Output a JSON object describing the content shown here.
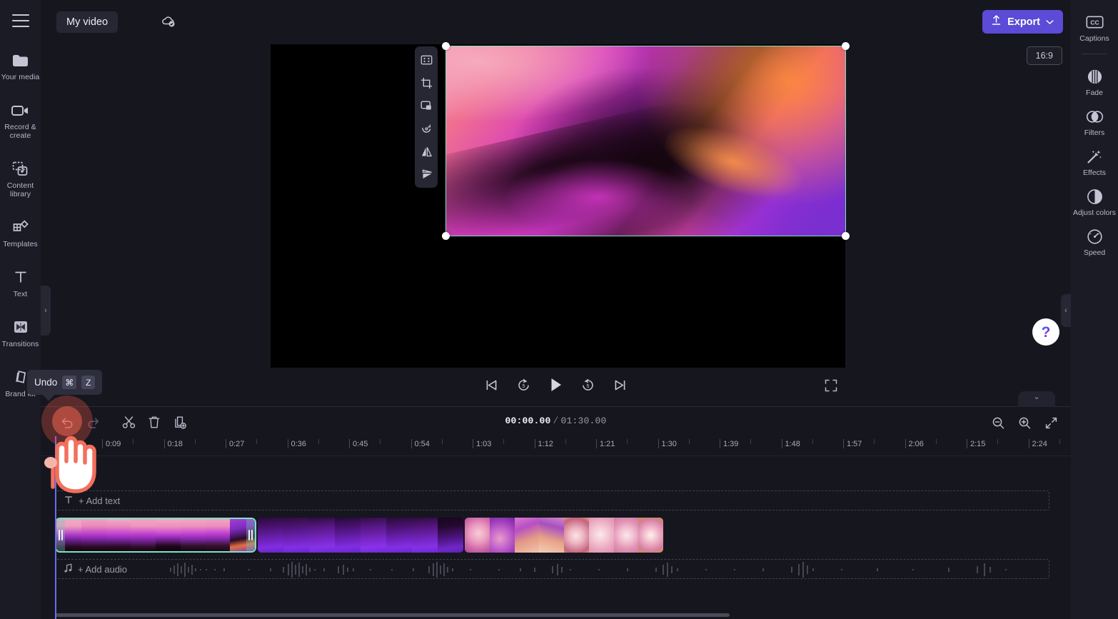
{
  "app": {
    "accent_purple": "#5b4bd6",
    "selection_green": "#79e4c4",
    "panel_bg": "#1b1b26",
    "stage_bg": "#16161f"
  },
  "topbar": {
    "menu_icon": "hamburger-menu-icon",
    "project_name": "My video",
    "save_status_icon": "cloud-saved-icon",
    "export_label": "Export",
    "export_icon": "upload-arrow-icon",
    "export_caret_icon": "chevron-down-icon"
  },
  "left_rail": {
    "items": [
      {
        "label": "Your media",
        "icon": "folder-icon"
      },
      {
        "label": "Record & create",
        "icon": "video-camera-icon"
      },
      {
        "label": "Content library",
        "icon": "content-library-icon"
      },
      {
        "label": "Templates",
        "icon": "templates-icon"
      },
      {
        "label": "Text",
        "icon": "text-t-icon"
      },
      {
        "label": "Transitions",
        "icon": "transitions-icon"
      },
      {
        "label": "Brand kit",
        "icon": "brand-kit-icon"
      }
    ],
    "expand_icon": "chevron-right-icon"
  },
  "right_rail": {
    "items": [
      {
        "label": "Captions",
        "icon": "closed-captions-icon"
      },
      {
        "label": "Fade",
        "icon": "fade-icon"
      },
      {
        "label": "Filters",
        "icon": "filters-icon"
      },
      {
        "label": "Effects",
        "icon": "effects-wand-icon"
      },
      {
        "label": "Adjust colors",
        "icon": "adjust-colors-icon"
      },
      {
        "label": "Speed",
        "icon": "speedometer-icon"
      }
    ],
    "collapse_icon": "chevron-left-icon"
  },
  "preview": {
    "aspect_ratio": "16:9",
    "float_toolbar": [
      {
        "icon": "fit-to-frame-icon"
      },
      {
        "icon": "crop-icon"
      },
      {
        "icon": "picture-in-picture-icon"
      },
      {
        "icon": "rotate-icon"
      },
      {
        "icon": "flip-horizontal-icon"
      },
      {
        "icon": "flip-vertical-icon"
      }
    ],
    "selection_handles": 4,
    "help_label": "?",
    "collapse_icon": "chevron-down-icon"
  },
  "playback": {
    "controls": [
      {
        "icon": "skip-to-start-icon"
      },
      {
        "icon": "rewind-5-icon"
      },
      {
        "icon": "play-icon"
      },
      {
        "icon": "forward-5-icon"
      },
      {
        "icon": "skip-to-end-icon"
      }
    ],
    "fullscreen_icon": "fullscreen-icon"
  },
  "timeline": {
    "tools": [
      {
        "icon": "undo-icon",
        "name": "undo"
      },
      {
        "icon": "redo-icon",
        "name": "redo"
      },
      {
        "icon": "split-scissors-icon",
        "name": "split"
      },
      {
        "icon": "delete-trash-icon",
        "name": "delete"
      },
      {
        "icon": "duplicate-icon",
        "name": "duplicate"
      }
    ],
    "current_time": "00:00.00",
    "separator": "/",
    "total_time": "01:30.00",
    "zoom_tools": [
      {
        "icon": "zoom-out-icon"
      },
      {
        "icon": "zoom-in-icon"
      },
      {
        "icon": "fit-timeline-icon"
      }
    ],
    "ruler_labels": [
      "0:09",
      "0:18",
      "0:27",
      "0:36",
      "0:45",
      "0:54",
      "1:03",
      "1:12",
      "1:21",
      "1:30",
      "1:39",
      "1:48",
      "1:57",
      "2:06",
      "2:15",
      "2:24"
    ],
    "tracks": {
      "text_label": "+ Add text",
      "text_icon": "text-t-icon",
      "audio_label": "+ Add audio",
      "audio_icon": "music-note-icon"
    },
    "clips": [
      {
        "name": "clip-1",
        "selected": true,
        "trim_handles": true
      },
      {
        "name": "clip-2",
        "selected": false,
        "trim_handles": false
      },
      {
        "name": "clip-3",
        "selected": false,
        "trim_handles": false
      }
    ]
  },
  "tooltip": {
    "text": "Undo",
    "key_modifier": "⌘",
    "key_letter": "Z"
  }
}
